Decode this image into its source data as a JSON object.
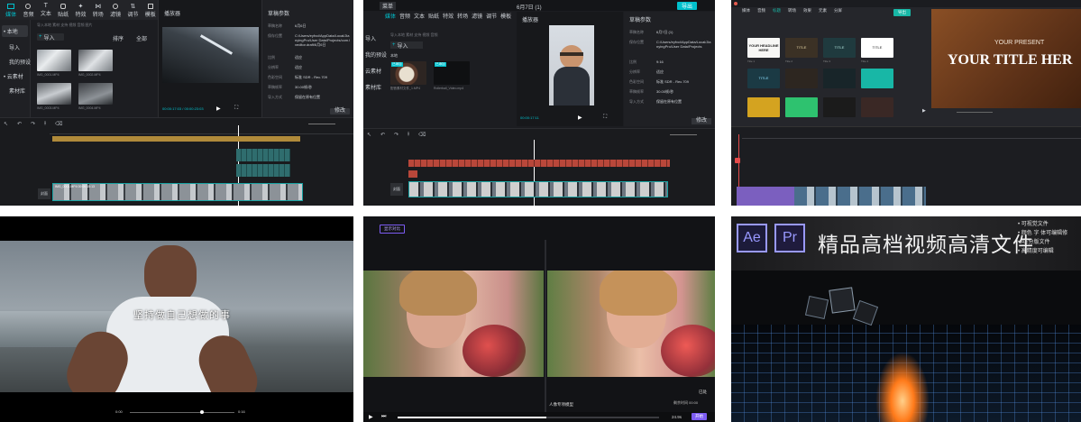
{
  "p1": {
    "toolbar": [
      "媒体",
      "音频",
      "文本",
      "贴纸",
      "特效",
      "转场",
      "滤镜",
      "调节",
      "模板"
    ],
    "sidebar": [
      "• 本地",
      "导入",
      "我的预设",
      "• 云素材",
      "素材库"
    ],
    "media_hint": "导入本地 素材 支持 视频 音频 图片",
    "import_label": "导入",
    "sort_label": "排序",
    "filter_label": "全部",
    "clips": [
      "IMG_0001.MP4",
      "IMG_0002.MP4",
      "IMG_0003.MP4",
      "IMG_0004.MP4",
      "IMG_0005.MP4"
    ],
    "player_title": "播放器",
    "timecode": "00:00:17:03 / 00:00:23:03",
    "props_title": "草稿参数",
    "props": [
      {
        "k": "草稿名称",
        "v": "6月6日"
      },
      {
        "k": "保存位置",
        "v": "C:/Users/eyfvci/AppData/Local/JianyingPro/User Data/Projects/com.lveditor.draft/6月6日"
      },
      {
        "k": "比例",
        "v": "适应"
      },
      {
        "k": "分辨率",
        "v": "适应"
      },
      {
        "k": "色彩空间",
        "v": "标准 SDR - Rec.709"
      },
      {
        "k": "草稿帧率",
        "v": "30.00帧/秒"
      },
      {
        "k": "导入方式",
        "v": "保留在原有位置"
      }
    ],
    "modify_button": "修改",
    "track_cover": "封面",
    "track_main_clip": "IMG_0001.MP4  00:00:15:13"
  },
  "p2": {
    "menu": "菜单",
    "window_title": "6月7日 (1)",
    "export_button": "导出",
    "toolbar": [
      "媒体",
      "音频",
      "文本",
      "贴纸",
      "特效",
      "转场",
      "滤镜",
      "调节",
      "模板"
    ],
    "sidebar": [
      "导入",
      "我的预设",
      "云素材",
      "素材库"
    ],
    "media_hint": "导入本地 素材 支持 视频 音频",
    "import_label": "导入",
    "tag_label": "本地",
    "clips": [
      "配音素材文件_1.MP4",
      "Rollerball_Video.mp4"
    ],
    "clip_badges": [
      "已添加",
      "已添加"
    ],
    "player_title": "播放器",
    "timecode": "00:00:17:11",
    "props_title": "草稿参数",
    "props": [
      {
        "k": "草稿名称",
        "v": "6月7日 (1)"
      },
      {
        "k": "保存位置",
        "v": "C:/Users/eyfvci/AppData/Local/JianyingPro/User Data/Projects"
      },
      {
        "k": "比例",
        "v": "9:16"
      },
      {
        "k": "分辨率",
        "v": "适应"
      },
      {
        "k": "色彩空间",
        "v": "标准 SDR - Rec.709"
      },
      {
        "k": "草稿帧率",
        "v": "30.00帧/秒"
      },
      {
        "k": "导入方式",
        "v": "保留在原有位置"
      }
    ],
    "modify_button": "修改",
    "track_cover": "封面"
  },
  "p3": {
    "toolbar": [
      "媒体",
      "音频",
      "标题",
      "转场",
      "效果",
      "元素",
      "分屏"
    ],
    "export_button": "导出",
    "templates": [
      "YOUR HEADLINE HERE",
      "TITLE",
      "TITLE",
      "TITLE",
      "TITLE"
    ],
    "items": [
      "Title 1",
      "Title 2",
      "Title 3",
      "Title 4",
      "Title 5",
      "Title 6",
      "Title 7",
      "Title 8",
      "Title 9",
      "Title 10",
      "Title 11",
      "Title 12"
    ],
    "preview_small": "YOUR PRESENT",
    "preview_big": "YOUR TITLE HER"
  },
  "p4": {
    "subtitle": "坚持做自己想做的事",
    "time_left": "0:00",
    "time_right": "0:16"
  },
  "p5": {
    "badge": "显示对比",
    "caption": "人像专项模型",
    "corner_right_top": "已处",
    "corner_right_bottom": "剩余时间 00:00",
    "time": "24.9s",
    "button": "开始"
  },
  "p6": {
    "ae": "Ae",
    "pr": "Pr",
    "title": "精品高档视频高清文件",
    "bullets": [
      "可视觉文件",
      "颜色 字 体可编辑修",
      "AE分版文件",
      "高精度可编辑"
    ]
  },
  "colors": {
    "accent": "#00c1cd",
    "ae": "#9999ff",
    "pr": "#9999ff",
    "clip_gold": "#b08a3a",
    "filmora_teal": "#18b7a6"
  }
}
